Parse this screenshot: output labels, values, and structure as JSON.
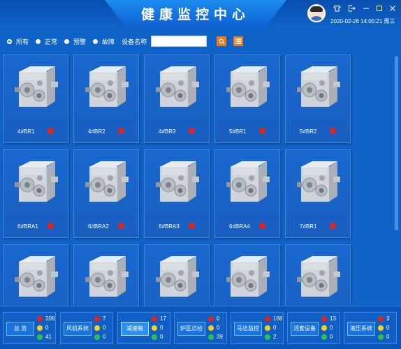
{
  "header": {
    "title": "健康监控中心",
    "datetime": "2020-02-26 14:05:21 周三",
    "controls": [
      "shirt-icon",
      "exit-icon",
      "minimize-icon",
      "maximize-icon",
      "close-icon"
    ]
  },
  "filter": {
    "options": [
      {
        "label": "所有",
        "checked": true
      },
      {
        "label": "正常",
        "checked": false
      },
      {
        "label": "预警",
        "checked": false
      },
      {
        "label": "故障",
        "checked": false
      }
    ],
    "device_name_label": "设备名称",
    "device_name_value": ""
  },
  "devices": [
    {
      "label": "4#BR1",
      "status_color": "#e32418"
    },
    {
      "label": "4#BR2",
      "status_color": "#e32418"
    },
    {
      "label": "4#BR3",
      "status_color": "#e32418"
    },
    {
      "label": "5#BR1",
      "status_color": "#e32418"
    },
    {
      "label": "5#BR2",
      "status_color": "#e32418"
    },
    {
      "label": "6#BRA1",
      "status_color": "#e32418"
    },
    {
      "label": "6#BRA2",
      "status_color": "#e32418"
    },
    {
      "label": "6#BRA3",
      "status_color": "#e32418"
    },
    {
      "label": "6#BRA4",
      "status_color": "#e32418"
    },
    {
      "label": "7#BR1",
      "status_color": "#e32418"
    },
    {
      "label": "",
      "status_color": ""
    },
    {
      "label": "",
      "status_color": ""
    },
    {
      "label": "",
      "status_color": ""
    },
    {
      "label": "",
      "status_color": ""
    },
    {
      "label": "",
      "status_color": ""
    }
  ],
  "colors": {
    "red": "#e32418",
    "yellow": "#f2d21a",
    "green": "#2fc24a"
  },
  "categories": [
    {
      "label": "总 览",
      "red": "208",
      "yellow": "0",
      "green": "41",
      "active": false
    },
    {
      "label": "风机系统",
      "red": "7",
      "yellow": "0",
      "green": "0",
      "active": false
    },
    {
      "label": "减速箱",
      "red": "17",
      "yellow": "0",
      "green": "0",
      "active": true
    },
    {
      "label": "炉区点检",
      "red": "0",
      "yellow": "0",
      "green": "39",
      "active": false
    },
    {
      "label": "马达监控",
      "red": "168",
      "yellow": "0",
      "green": "2",
      "active": false
    },
    {
      "label": "活套设备",
      "red": "13",
      "yellow": "0",
      "green": "0",
      "active": false
    },
    {
      "label": "液压系统",
      "red": "3",
      "yellow": "0",
      "green": "0",
      "active": false
    }
  ]
}
